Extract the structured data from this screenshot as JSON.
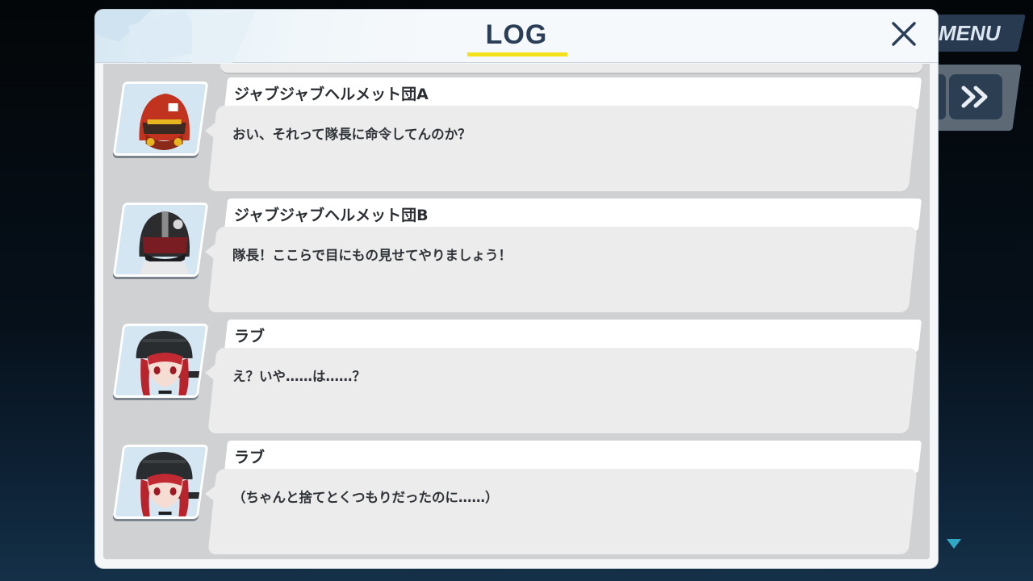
{
  "hud": {
    "menu_label": "MENU"
  },
  "log": {
    "title": "LOG",
    "close_icon": "close-icon",
    "entries": [
      {
        "speaker": "ジャブジャブヘルメット団A",
        "message": "おい、それって隊長に命令してんのか？",
        "portrait": "red-helmet-trooper"
      },
      {
        "speaker": "ジャブジャブヘルメット団B",
        "message": "隊長！ここらで目にもの見せてやりましょう！",
        "portrait": "black-helmet-trooper"
      },
      {
        "speaker": "ラブ",
        "message": "え？いや……は……？",
        "portrait": "love-red-hair-helmet"
      },
      {
        "speaker": "ラブ",
        "message": "（ちゃんと捨てとくつもりだったのに……）",
        "portrait": "love-red-hair-helmet"
      }
    ]
  },
  "colors": {
    "title_text": "#2a3f57",
    "title_underline": "#f3e21a",
    "panel_bg": "#f4f6f8",
    "log_area_bg": "#cfd1d3",
    "name_tab_bg": "#ffffff",
    "message_bg": "#ececec"
  }
}
